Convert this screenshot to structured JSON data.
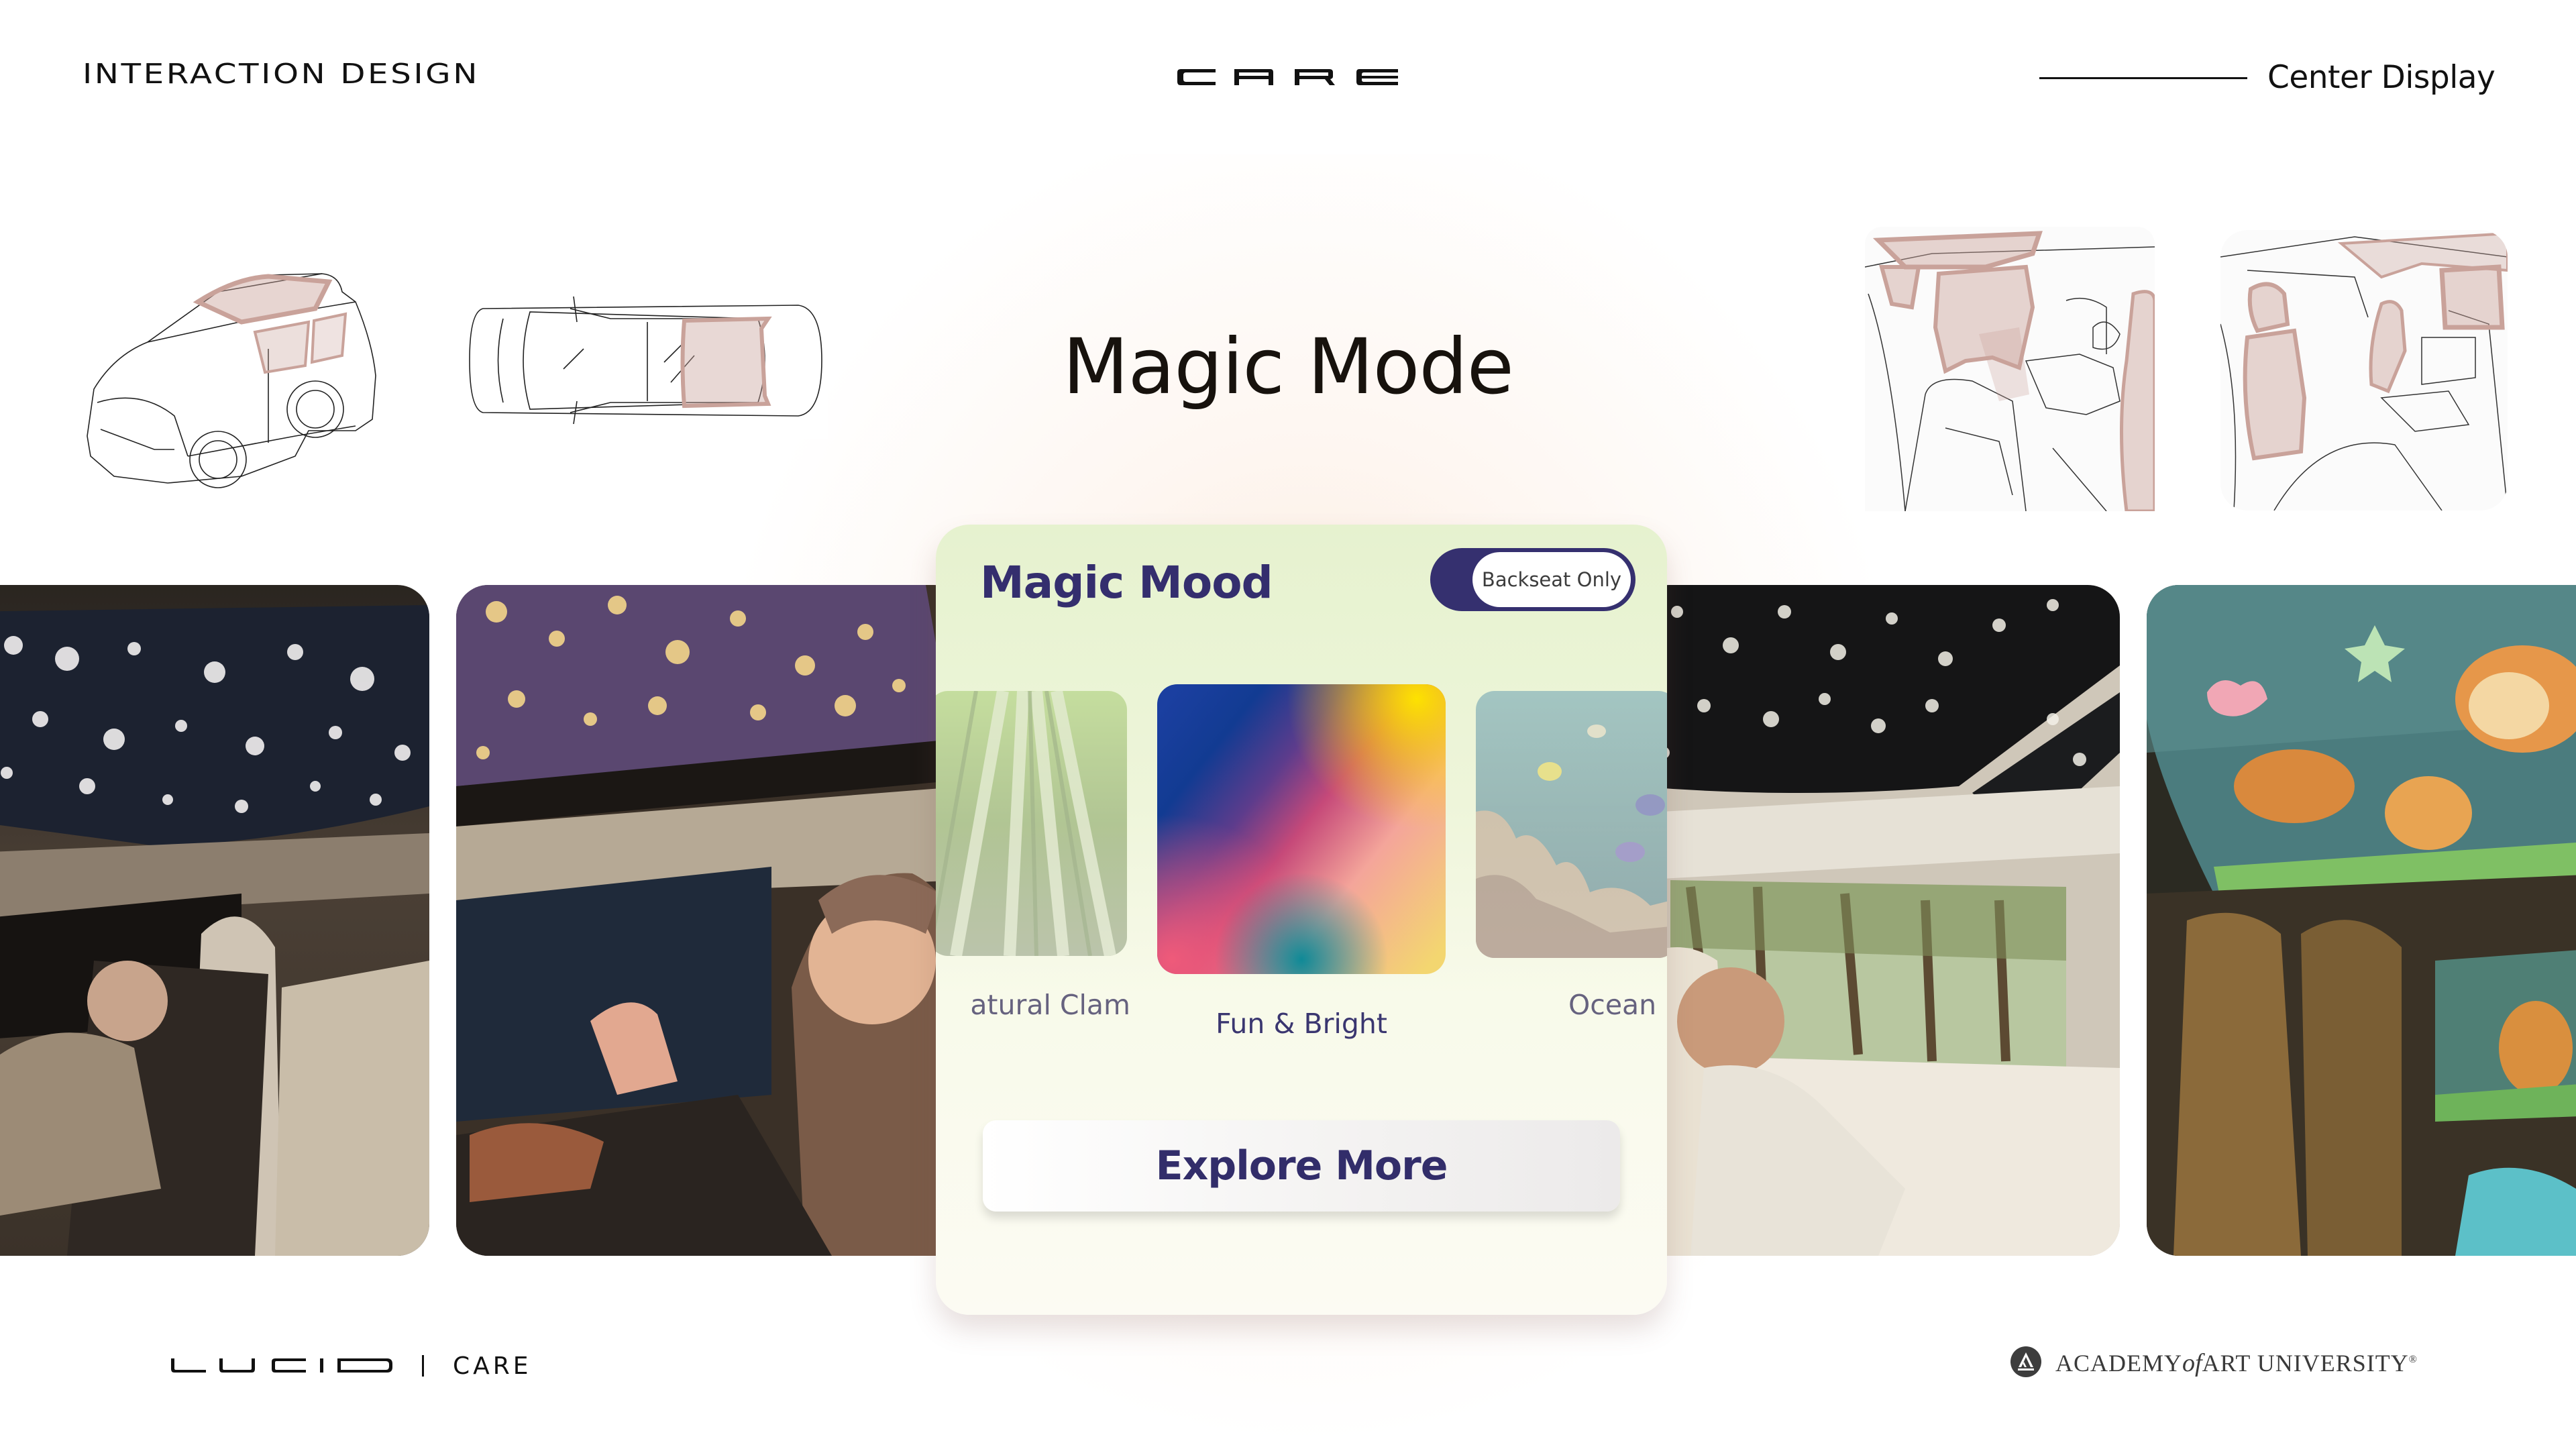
{
  "header": {
    "section_label": "INTERACTION DESIGN",
    "brand_logo": "CARE",
    "page_context": "Center Display"
  },
  "page_title": "Magic Mode",
  "sketches": [
    {
      "name": "car-exterior-3-4-sketch",
      "description": "SUV three-quarter sketch with highlighted panoramic roof"
    },
    {
      "name": "car-top-view-sketch",
      "description": "SUV top view sketch with highlighted rear roof area"
    },
    {
      "name": "interior-rear-sketch-1",
      "description": "Interior sketch with highlighted windows and seatback"
    },
    {
      "name": "interior-rear-sketch-2",
      "description": "Interior sketch with highlighted headrests and windows"
    }
  ],
  "photos": [
    {
      "name": "photo-snowflake-sunroof",
      "description": "Baby in car seat watching snowflake projection on sunroof"
    },
    {
      "name": "photo-blossom-sunroof",
      "description": "Baby in car seat watching blossom tree projection on sunroof"
    },
    {
      "name": "photo-animal-stars-sunroof",
      "description": "Baby looking out window under starry animal sunroof"
    },
    {
      "name": "photo-cartoon-sunroof",
      "description": "Cartoon animals projected on sunroof and rear window"
    }
  ],
  "card": {
    "title": "Magic Mood",
    "toggle": {
      "label": "Backseat Only",
      "state": "on"
    },
    "moods": [
      {
        "label": "Natural Clam",
        "visible_label": "atural Clam",
        "selected": false,
        "icon": "bamboo-forest"
      },
      {
        "label": "Fun & Bright",
        "selected": true,
        "icon": "rainbow-gradient"
      },
      {
        "label": "Ocean",
        "selected": false,
        "icon": "coral-reef"
      }
    ],
    "explore_button": "Explore More"
  },
  "footer": {
    "brand_logo": "LUCID",
    "separator": "|",
    "brand_sub": "CARE",
    "school": {
      "pre": "ACADEMY",
      "of": "of",
      "post": "ART UNIVERSITY",
      "mark": "®"
    }
  },
  "colors": {
    "accent_navy": "#342E6E",
    "sketch_highlight": "#C9A29A",
    "card_bg_top": "#E6F2CF",
    "card_bg_bottom": "#FCFBF3",
    "text_dark": "#111111"
  }
}
